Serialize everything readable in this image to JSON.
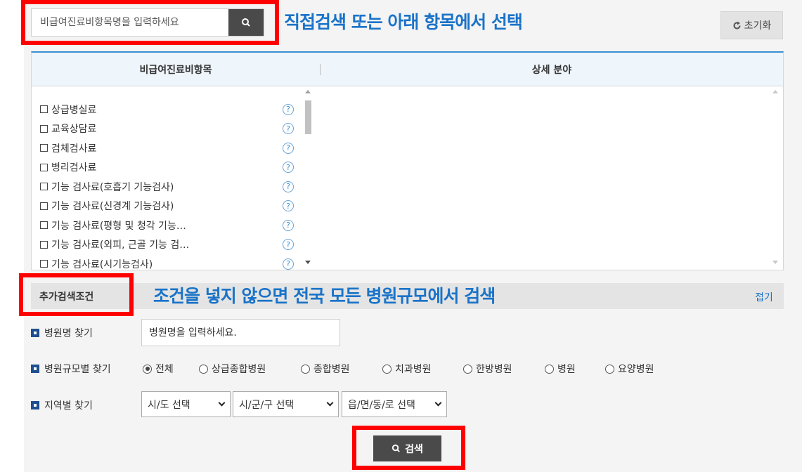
{
  "top": {
    "search_placeholder": "비급여진료비항목명을 입력하세요",
    "annotation": "직접검색 또는 아래 항목에서 선택",
    "reset_label": "초기화"
  },
  "grid": {
    "col_items": "비급여진료비항목",
    "col_detail": "상세 분야",
    "items": [
      "상급병실료",
      "교육상담료",
      "검체검사료",
      "병리검사료",
      "기능 검사료(호흡기 기능검사)",
      "기능 검사료(신경계 기능검사)",
      "기능 검사료(평형 및 청각 기능…",
      "기능 검사료(외피, 근골 기능 검…",
      "기능 검사료(시기능검사)"
    ]
  },
  "conditions": {
    "label": "추가검색조건",
    "annotation": "조건을 넣지 않으면 전국 모든 병원규모에서 검색",
    "fold_label": "접기"
  },
  "hospital_name": {
    "label": "병원명 찾기",
    "placeholder": "병원명을 입력하세요."
  },
  "hospital_size": {
    "label": "병원규모별 찾기",
    "options": [
      "전체",
      "상급종합병원",
      "종합병원",
      "치과병원",
      "한방병원",
      "병원",
      "요양병원"
    ],
    "selected": "전체"
  },
  "region": {
    "label": "지역별 찾기",
    "sido": "시/도 선택",
    "sigungu": "시/군/구 선택",
    "eupmyeon": "읍/면/동/로 선택"
  },
  "search_button_label": "검색",
  "colors": {
    "annotation": "#1a73c8",
    "highlight": "#ff0000",
    "header_border": "#3b8fd3"
  }
}
